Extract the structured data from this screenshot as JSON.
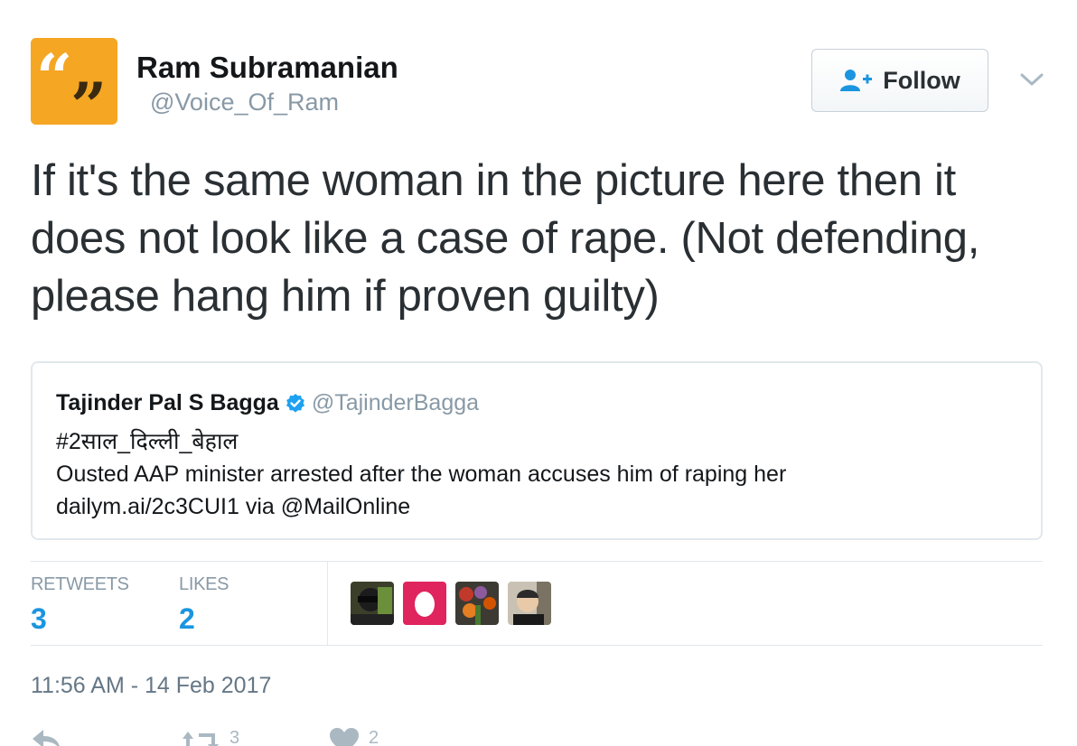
{
  "author": {
    "name": "Ram Subramanian",
    "handle": "@Voice_Of_Ram",
    "avatar_color": "#f5a623",
    "avatar_icon": "quote-marks-icon"
  },
  "follow_button": {
    "label": "Follow",
    "icon": "add-user-icon"
  },
  "tweet": {
    "text": "If it's the same woman in the picture here then it does not look like a case of rape. (Not defending, please hang him if proven guilty)"
  },
  "quoted_tweet": {
    "name": "Tajinder Pal S Bagga",
    "handle": "@TajinderBagga",
    "verified": true,
    "hashtag": "#2साल_दिल्ली_बेहाल",
    "line1": "Ousted AAP minister arrested after the woman accuses him of raping her",
    "link": "dailym.ai/2c3CUI1",
    "via": "via @MailOnline"
  },
  "stats": {
    "retweets_label": "RETWEETS",
    "retweets_value": "3",
    "likes_label": "LIKES",
    "likes_value": "2"
  },
  "timestamp": "11:56 AM - 14 Feb 2017",
  "actions": {
    "retweet_count": "3",
    "like_count": "2"
  },
  "colors": {
    "link_blue": "#1b95e0",
    "muted": "#8899a6",
    "border": "#e1e8ed"
  }
}
